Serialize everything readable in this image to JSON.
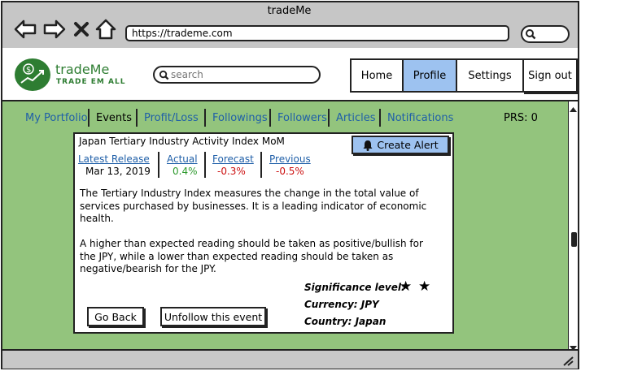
{
  "window": {
    "title": "tradeMe"
  },
  "browser": {
    "url": "https://trademe.com"
  },
  "header": {
    "logo_name": "tradeMe",
    "logo_tagline": "TRADE EM ALL",
    "search_placeholder": "search",
    "nav": {
      "home": "Home",
      "profile": "Profile",
      "settings": "Settings",
      "signout": "Sign out"
    }
  },
  "tabs": [
    {
      "label": "My Portfolio"
    },
    {
      "label": "Events"
    },
    {
      "label": "Profit/Loss"
    },
    {
      "label": "Followings"
    },
    {
      "label": "Followers"
    },
    {
      "label": "Articles"
    },
    {
      "label": "Notifications"
    }
  ],
  "active_tab": "Events",
  "prs": "PRS: 0",
  "event": {
    "title": "Japan Tertiary Industry Activity Index MoM",
    "create_alert": "Create Alert",
    "metrics": {
      "latest_release": {
        "label": "Latest Release",
        "value": "Mar 13, 2019"
      },
      "actual": {
        "label": "Actual",
        "value": "0.4%"
      },
      "forecast": {
        "label": "Forecast",
        "value": "-0.3%"
      },
      "previous": {
        "label": "Previous",
        "value": "-0.5%"
      }
    },
    "description_1": "The Tertiary Industry Index measures the change in the total value of services purchased by businesses. It is a leading indicator of economic health.",
    "description_2": "A higher than expected reading should be taken as positive/bullish for the JPY, while a lower than expected reading should be taken as negative/bearish for the JPY.",
    "significance_label": "Significance level:",
    "significance_stars": 2,
    "currency": "Currency: JPY",
    "country": "Country: Japan",
    "go_back": "Go Back",
    "unfollow": "Unfollow this event"
  },
  "colors": {
    "accent_blue": "#9dc2f0",
    "content_green": "#93c47d",
    "logo_green": "#2e7d32",
    "link_blue": "#1f5fa8",
    "positive": "#2e9a2e",
    "negative": "#cc1111"
  }
}
